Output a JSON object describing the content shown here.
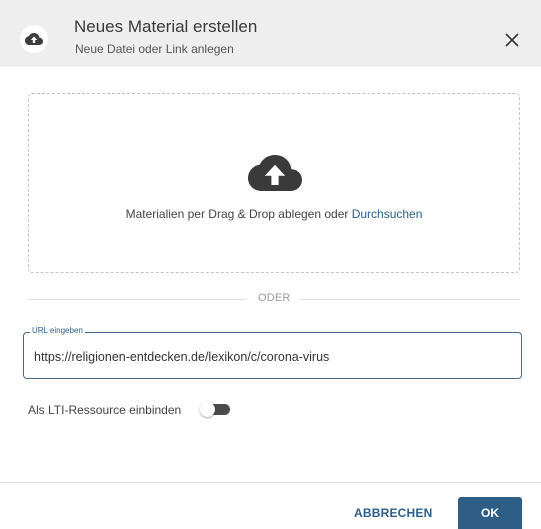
{
  "dialog": {
    "title": "Neues Material erstellen",
    "subtitle": "Neue Datei oder Link anlegen",
    "header_icon": "cloud-upload-icon",
    "close_icon": "close-icon"
  },
  "dropzone": {
    "icon": "cloud-upload-icon",
    "text": "Materialien per Drag & Drop ablegen oder ",
    "browse_link": "Durchsuchen"
  },
  "divider": {
    "text": "ODER"
  },
  "url_field": {
    "label": "URL eingeben",
    "value": "https://religionen-entdecken.de/lexikon/c/corona-virus"
  },
  "lti": {
    "label": "Als LTI-Ressource einbinden",
    "enabled": false
  },
  "footer": {
    "cancel_label": "ABBRECHEN",
    "ok_label": "OK"
  },
  "colors": {
    "accent": "#2e5e86",
    "link": "#2b5e8c",
    "header_bg": "#eeeeee"
  }
}
